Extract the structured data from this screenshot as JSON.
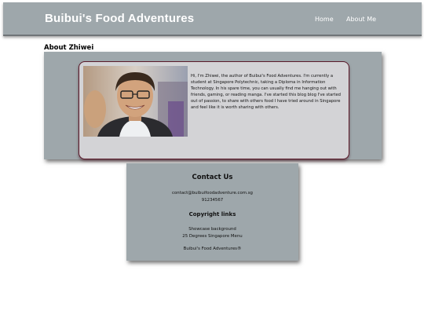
{
  "nav": {
    "brand": "Buibui's Food Adventures",
    "links": [
      {
        "label": "Home"
      },
      {
        "label": "About Me"
      }
    ]
  },
  "about": {
    "heading": "About Zhiwei",
    "bio": "Hi, I'm Zhiwei, the author of Buibui's Food Adventures. I'm currently a student at Singapore Polytechnic, taking a Diploma in Information Technology. In his spare time, you can usually find me hanging out with friends, gaming, or reading manga. I've started this blog blog I've started out of passion, to share with others food I have tried around in Singapore and feel like it is worth sharing with others."
  },
  "contact": {
    "heading": "Contact Us",
    "email": "contact@buibuifoodadventure.com.sg",
    "phone": "91234567"
  },
  "copyright": {
    "heading": "Copyright links",
    "links": [
      "Showcase background",
      "25 Degrees Singapore Menu"
    ],
    "footer": "Buibui's Food Adventures®"
  }
}
